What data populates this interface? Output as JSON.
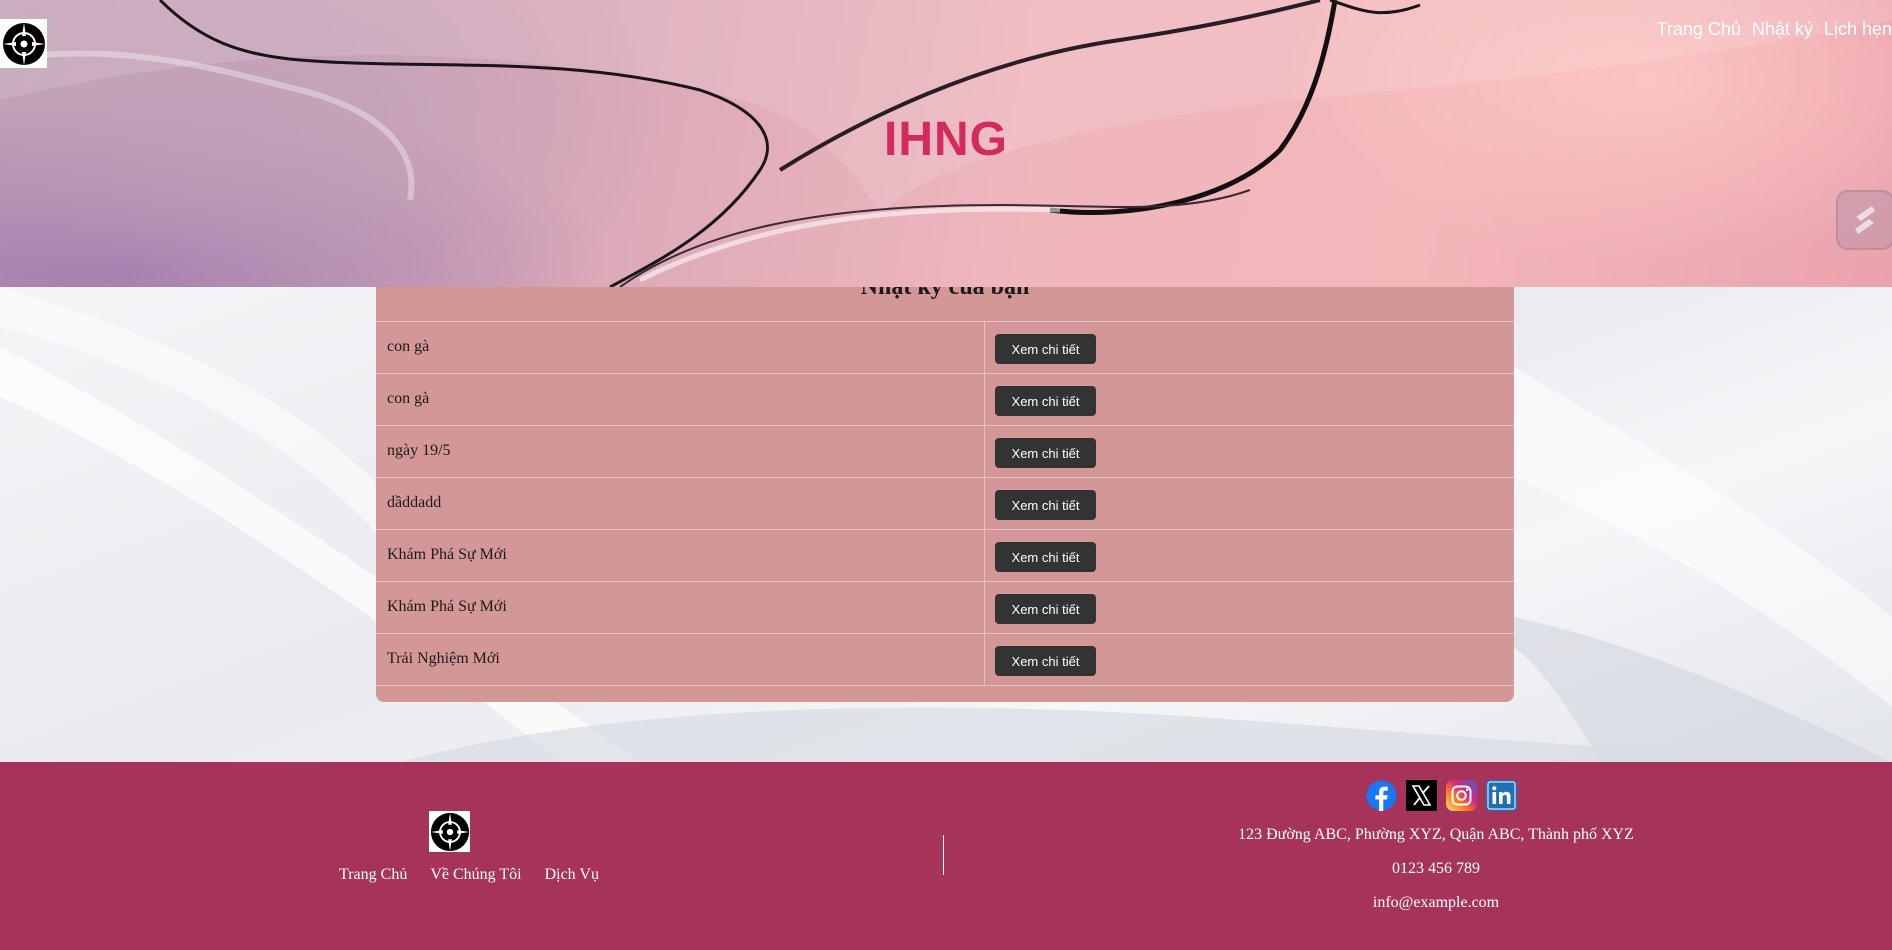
{
  "header": {
    "brand": "IHNG",
    "nav": [
      "Trang Chủ",
      "Nhật ký",
      "Lịch hẹn"
    ]
  },
  "journal": {
    "title": "Nhật ký của bạn",
    "button_label": "Xem chi tiết",
    "entries": [
      "con gà",
      "con gà",
      "ngày 19/5",
      "dầddadd",
      "Khám Phá Sự Mới",
      "Khám Phá Sự Mới",
      "Trải Nghiệm Mới"
    ]
  },
  "footer": {
    "links": [
      "Trang Chủ",
      "Về Chúng Tôi",
      "Dịch Vụ"
    ],
    "socials": [
      "facebook-icon",
      "x-icon",
      "instagram-icon",
      "linkedin-icon"
    ],
    "address": "123 Đường ABC, Phường XYZ, Quận ABC, Thành phố XYZ",
    "phone": "0123 456 789",
    "email": "info@example.com"
  },
  "colors": {
    "brand": "#d32b5d",
    "table_bg": "#d49797",
    "button_bg": "#333333",
    "footer_bg": "#a5335a"
  }
}
